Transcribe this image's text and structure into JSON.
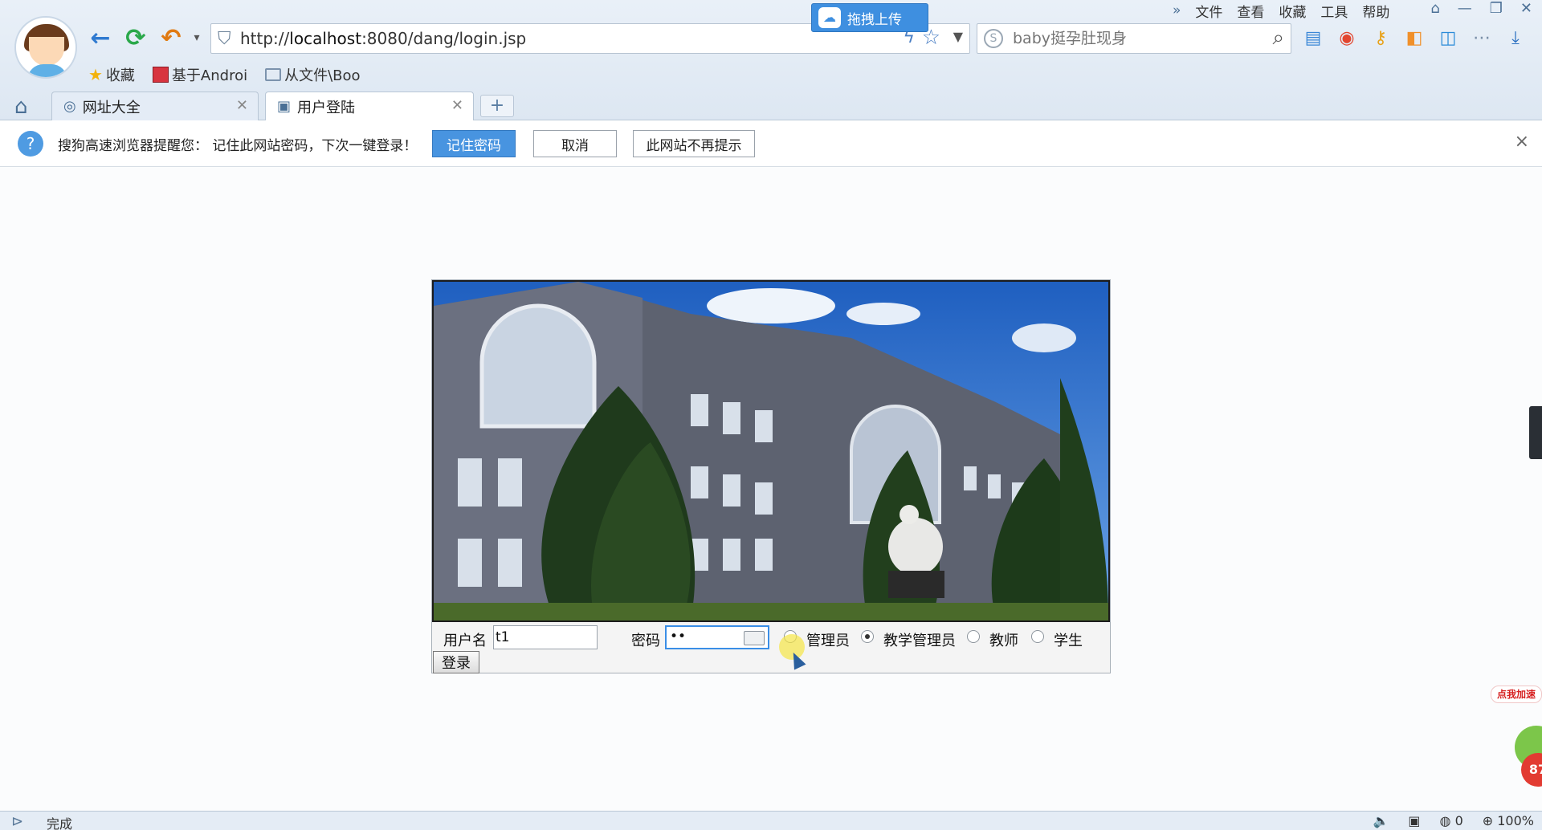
{
  "browser": {
    "url_prefix": "http://",
    "url_host": "localhost",
    "url_rest": ":8080/dang/login.jsp",
    "search_placeholder": "baby挺孕肚现身",
    "menu": [
      "文件",
      "查看",
      "收藏",
      "工具",
      "帮助"
    ],
    "cloud_upload_label": "拖拽上传",
    "favorites": [
      {
        "label": "收藏",
        "icon": "star-icon"
      },
      {
        "label": "基于Androi",
        "icon": "bookmark-icon"
      },
      {
        "label": "从文件\\Boo",
        "icon": "folder-icon"
      }
    ],
    "tabs": [
      {
        "label": "网址大全",
        "icon": "globe-icon",
        "active": false
      },
      {
        "label": "用户登陆",
        "icon": "page-icon",
        "active": true
      }
    ],
    "new_tab_label": "+"
  },
  "notification": {
    "message": "搜狗高速浏览器提醒您： 记住此网站密码，下次一键登录！",
    "remember_label": "记住密码",
    "cancel_label": "取消",
    "never_label": "此网站不再提示",
    "close_label": "×"
  },
  "login": {
    "username_label": "用户名",
    "username_value": "t1",
    "password_label": "密码",
    "password_value": "••",
    "roles": [
      {
        "label": "管理员",
        "checked": false
      },
      {
        "label": "教学管理员",
        "checked": true
      },
      {
        "label": "教师",
        "checked": false
      },
      {
        "label": "学生",
        "checked": false
      }
    ],
    "submit_label": "登录"
  },
  "speed_widget": {
    "tag": "点我加速",
    "count": "87"
  },
  "status": {
    "text": "完成",
    "counter": "0",
    "zoom": "100%"
  },
  "colors": {
    "accent": "#4894e0",
    "chrome_bg": "#e4ecf6"
  }
}
